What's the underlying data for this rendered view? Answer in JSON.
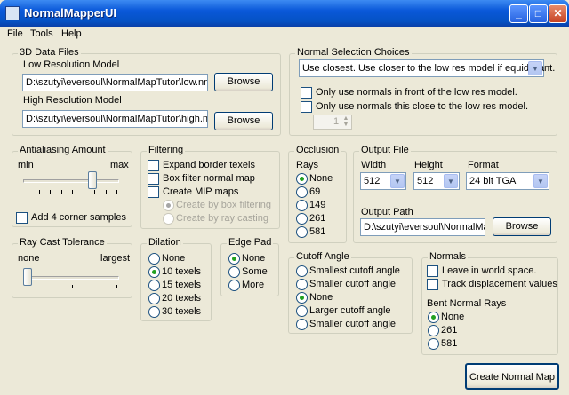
{
  "window": {
    "title": "NormalMapperUI"
  },
  "menu": [
    "File",
    "Tools",
    "Help"
  ],
  "data_files": {
    "title": "3D Data Files",
    "low_label": "Low Resolution Model",
    "low_path": "D:\\szutyi\\eversoul\\NormalMapTutor\\low.nmf",
    "high_label": "High Resolution Model",
    "high_path": "D:\\szutyi\\eversoul\\NormalMapTutor\\high.nmf",
    "browse": "Browse"
  },
  "normal_selection": {
    "title": "Normal Selection Choices",
    "selected": "Use closest. Use closer to the low res model if equidistant.",
    "only_front": "Only use normals in front of the low res model.",
    "only_close": "Only use normals this close to the low res model.",
    "distance": "1"
  },
  "antialiasing": {
    "title": "Antialiasing Amount",
    "min": "min",
    "max": "max",
    "level": 0.73,
    "corner_samples": "Add 4 corner samples"
  },
  "filtering": {
    "title": "Filtering",
    "expand": "Expand border texels",
    "box_filter": "Box filter normal map",
    "mip": "Create MIP maps",
    "by_box": "Create by box filtering",
    "by_ray": "Create by ray casting"
  },
  "occlusion": {
    "title": "Occlusion",
    "rays_label": "Rays",
    "options": [
      "None",
      "69",
      "149",
      "261",
      "581"
    ],
    "selected": "None"
  },
  "output_file": {
    "title": "Output File",
    "width_label": "Width",
    "width": "512",
    "height_label": "Height",
    "height": "512",
    "format_label": "Format",
    "format": "24 bit TGA",
    "path_label": "Output Path",
    "path": "D:\\szutyi\\eversoul\\NormalMap",
    "browse": "Browse"
  },
  "ray_cast": {
    "title": "Ray Cast Tolerance",
    "none": "none",
    "largest": "largest",
    "level": 0.0
  },
  "dilation": {
    "title": "Dilation",
    "options": [
      "None",
      "10 texels",
      "15 texels",
      "20 texels",
      "30 texels"
    ],
    "selected": "10 texels"
  },
  "edge_pad": {
    "title": "Edge Pad",
    "options": [
      "None",
      "Some",
      "More"
    ],
    "selected": "None"
  },
  "cutoff": {
    "title": "Cutoff Angle",
    "options": [
      "Smallest cutoff angle",
      "Smaller cutoff angle",
      "None",
      "Larger cutoff angle",
      "Smaller cutoff angle"
    ],
    "selected_index": 2
  },
  "normals": {
    "title": "Normals",
    "world_space": "Leave in world space.",
    "track": "Track displacement values",
    "bent_label": "Bent Normal Rays",
    "bent_options": [
      "None",
      "261",
      "581"
    ],
    "bent_selected": "None"
  },
  "create_button": "Create Normal Map"
}
